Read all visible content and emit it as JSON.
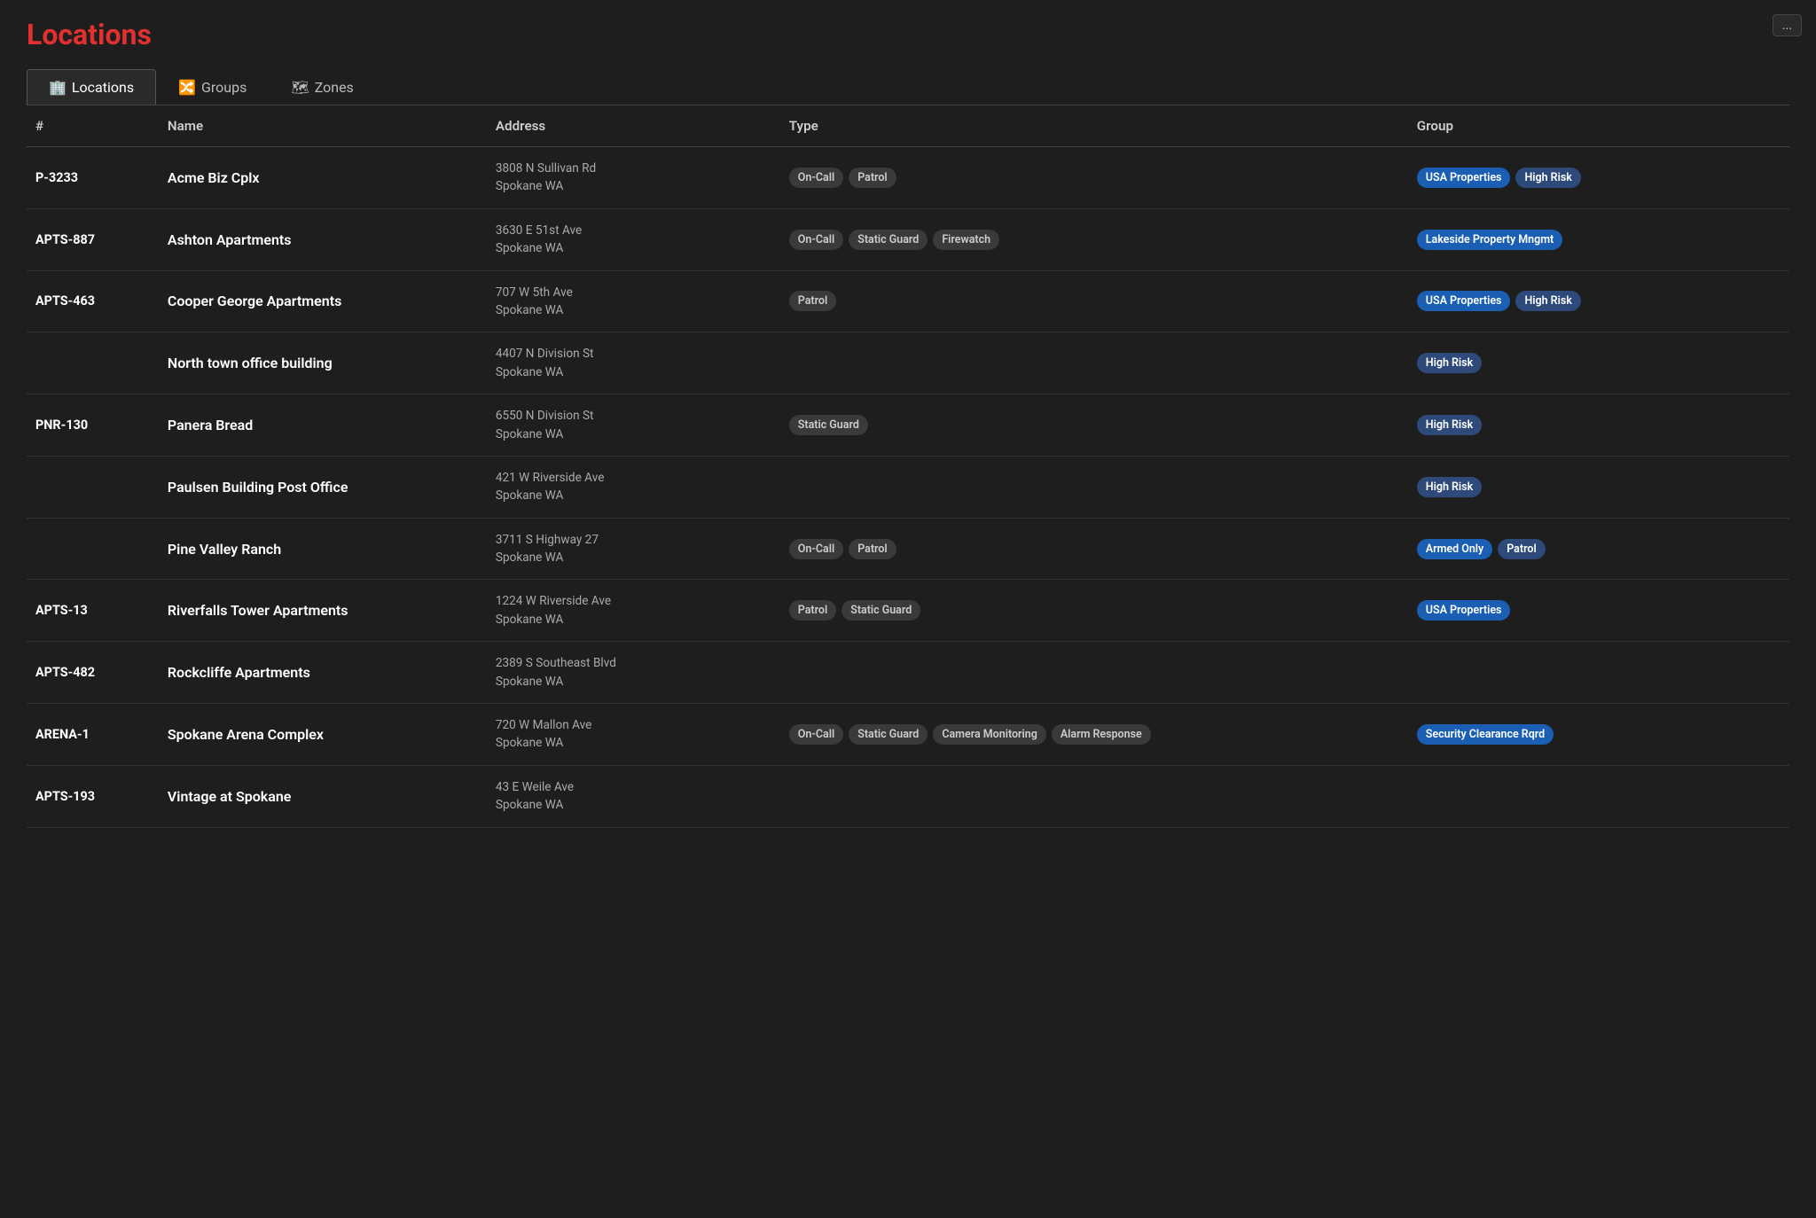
{
  "title": "Locations",
  "topRightButton": "...",
  "tabs": [
    {
      "id": "locations",
      "label": "Locations",
      "icon": "🏢",
      "active": true
    },
    {
      "id": "groups",
      "label": "Groups",
      "icon": "🔀",
      "active": false
    },
    {
      "id": "zones",
      "label": "Zones",
      "icon": "🗺",
      "active": false
    }
  ],
  "table": {
    "columns": [
      "#",
      "Name",
      "Address",
      "Type",
      "Group"
    ],
    "rows": [
      {
        "num": "P-3233",
        "name": "Acme Biz Cplx",
        "address": [
          "3808 N Sullivan Rd",
          "Spokane WA"
        ],
        "types": [
          "On-Call",
          "Patrol"
        ],
        "groups": [
          {
            "label": "USA Properties",
            "style": "blue"
          },
          {
            "label": "High Risk",
            "style": "dark"
          }
        ]
      },
      {
        "num": "APTS-887",
        "name": "Ashton Apartments",
        "address": [
          "3630 E 51st Ave",
          "Spokane WA"
        ],
        "types": [
          "On-Call",
          "Static Guard",
          "Firewatch"
        ],
        "groups": [
          {
            "label": "Lakeside Property Mngmt",
            "style": "blue"
          }
        ]
      },
      {
        "num": "APTS-463",
        "name": "Cooper George Apartments",
        "address": [
          "707 W 5th Ave",
          "Spokane WA"
        ],
        "types": [
          "Patrol"
        ],
        "groups": [
          {
            "label": "USA Properties",
            "style": "blue"
          },
          {
            "label": "High Risk",
            "style": "dark"
          }
        ]
      },
      {
        "num": "",
        "name": "North town office building",
        "address": [
          "4407 N Division St",
          "Spokane WA"
        ],
        "types": [],
        "groups": [
          {
            "label": "High Risk",
            "style": "dark"
          }
        ]
      },
      {
        "num": "PNR-130",
        "name": "Panera Bread",
        "address": [
          "6550 N Division St",
          "Spokane WA"
        ],
        "types": [
          "Static Guard"
        ],
        "groups": [
          {
            "label": "High Risk",
            "style": "dark"
          }
        ]
      },
      {
        "num": "",
        "name": "Paulsen Building Post Office",
        "address": [
          "421 W Riverside Ave",
          "Spokane WA"
        ],
        "types": [],
        "groups": [
          {
            "label": "High Risk",
            "style": "dark"
          }
        ]
      },
      {
        "num": "",
        "name": "Pine Valley Ranch",
        "address": [
          "3711 S Highway 27",
          "Spokane WA"
        ],
        "types": [
          "On-Call",
          "Patrol"
        ],
        "groups": [
          {
            "label": "Armed Only",
            "style": "blue"
          },
          {
            "label": "Patrol",
            "style": "dark"
          }
        ]
      },
      {
        "num": "APTS-13",
        "name": "Riverfalls Tower Apartments",
        "address": [
          "1224 W Riverside Ave",
          "Spokane WA"
        ],
        "types": [
          "Patrol",
          "Static Guard"
        ],
        "groups": [
          {
            "label": "USA Properties",
            "style": "blue"
          }
        ]
      },
      {
        "num": "APTS-482",
        "name": "Rockcliffe Apartments",
        "address": [
          "2389 S Southeast Blvd",
          "Spokane WA"
        ],
        "types": [],
        "groups": []
      },
      {
        "num": "ARENA-1",
        "name": "Spokane Arena Complex",
        "address": [
          "720 W Mallon Ave",
          "Spokane WA"
        ],
        "types": [
          "On-Call",
          "Static Guard",
          "Camera Monitoring",
          "Alarm Response"
        ],
        "groups": [
          {
            "label": "Security Clearance Rqrd",
            "style": "blue"
          }
        ]
      },
      {
        "num": "APTS-193",
        "name": "Vintage at Spokane",
        "address": [
          "43 E Weile Ave",
          "Spokane WA"
        ],
        "types": [],
        "groups": []
      }
    ]
  }
}
